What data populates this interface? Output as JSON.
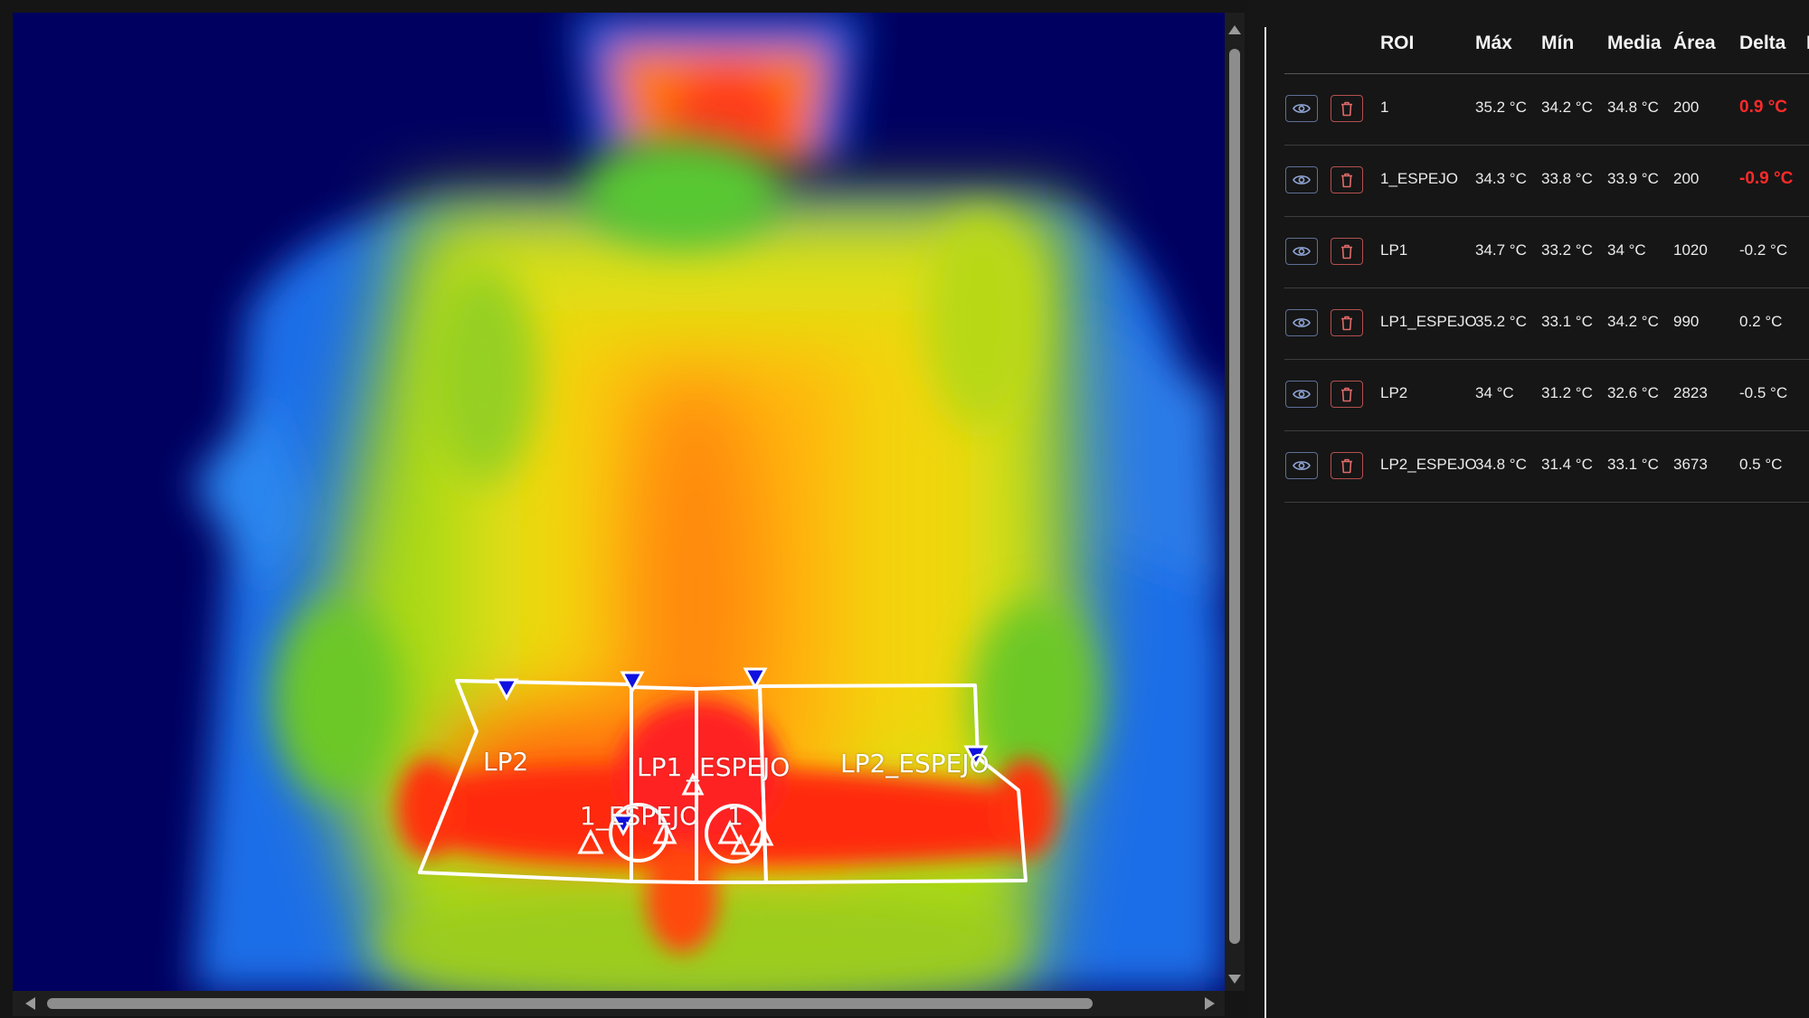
{
  "image_view": {
    "overlay_labels": {
      "lp2": "LP2",
      "lp1": "LP1",
      "espejo_fragment": "_ESPEJO",
      "lp2_espejo": "LP2_ESPEJO",
      "one_espejo": "1_ESPEJO",
      "one": "1"
    }
  },
  "roi_table": {
    "headers": {
      "roi": "ROI",
      "max": "Máx",
      "min": "Mín",
      "mean": "Media",
      "area": "Área",
      "delta": "Delta",
      "extra": "I"
    },
    "rows": [
      {
        "name": "1",
        "max": "35.2 °C",
        "min": "34.2 °C",
        "mean": "34.8 °C",
        "area": "200",
        "delta": "0.9 °C",
        "delta_highlight": true
      },
      {
        "name": "1_ESPEJO",
        "max": "34.3 °C",
        "min": "33.8 °C",
        "mean": "33.9 °C",
        "area": "200",
        "delta": "-0.9 °C",
        "delta_highlight": true
      },
      {
        "name": "LP1",
        "max": "34.7 °C",
        "min": "33.2 °C",
        "mean": "34 °C",
        "area": "1020",
        "delta": "-0.2 °C",
        "delta_highlight": false
      },
      {
        "name": "LP1_ESPEJO",
        "max": "35.2 °C",
        "min": "33.1 °C",
        "mean": "34.2 °C",
        "area": "990",
        "delta": "0.2 °C",
        "delta_highlight": false
      },
      {
        "name": "LP2",
        "max": "34 °C",
        "min": "31.2 °C",
        "mean": "32.6 °C",
        "area": "2823",
        "delta": "-0.5 °C",
        "delta_highlight": false
      },
      {
        "name": "LP2_ESPEJO",
        "max": "34.8 °C",
        "min": "31.4 °C",
        "mean": "33.1 °C",
        "area": "3673",
        "delta": "0.5 °C",
        "delta_highlight": false
      }
    ]
  },
  "icons": {
    "visibility": "eye-icon",
    "delete": "trash-icon"
  },
  "colors": {
    "delta_highlight": "#ff2a2a",
    "eye_button_border": "#5e7096",
    "trash_button_border": "#b45050",
    "background": "#161616"
  }
}
